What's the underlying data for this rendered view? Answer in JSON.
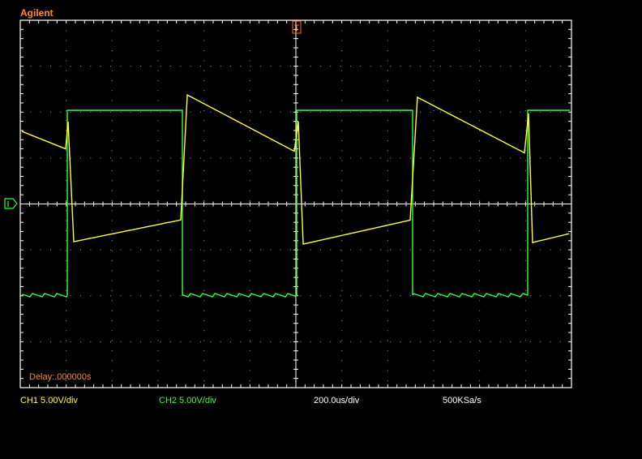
{
  "brand": "Agilent",
  "delay_text": "Delay:.000000s",
  "status": {
    "ch1_scale": "CH1 5.00V/div",
    "ch2_scale": "CH2 5.00V/div",
    "timebase": "200.0us/div",
    "sample_rate": "500KSa/s"
  },
  "colors": {
    "ch1": "#ffff33",
    "ch2": "#33ff33",
    "brand": "#ff8a1c",
    "grid": "#ffffff",
    "trigger": "#ff6a1c",
    "background": "#000000"
  },
  "markers": {
    "trigger_icon": "trigger-position-marker",
    "ground_icon": "channel-ground-reference-marker"
  }
}
